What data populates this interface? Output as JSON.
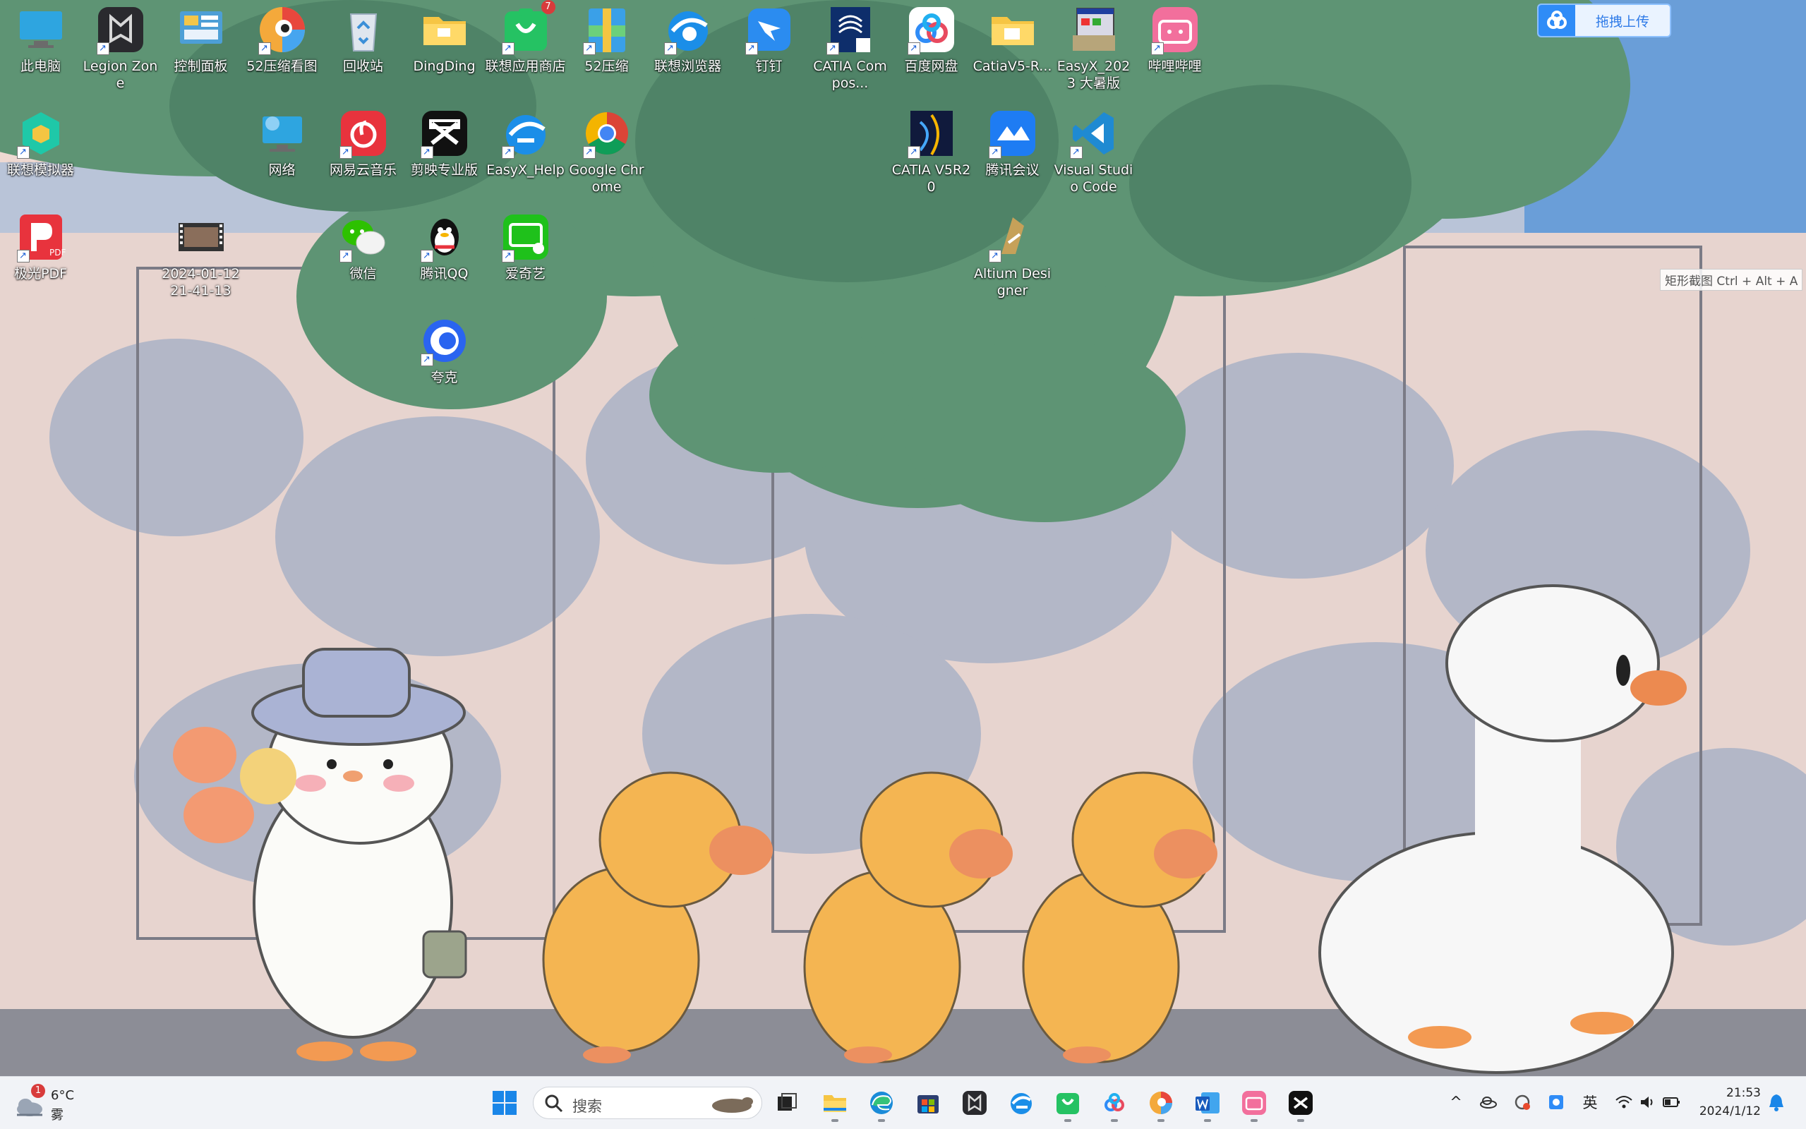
{
  "desktop": {
    "icons": [
      {
        "label": "此电脑",
        "icon": "computer-icon"
      },
      {
        "label": "Legion Zone",
        "icon": "legion-zone-icon"
      },
      {
        "label": "控制面板",
        "icon": "control-panel-icon"
      },
      {
        "label": "52压缩看图",
        "icon": "image-viewer-icon"
      },
      {
        "label": "回收站",
        "icon": "recycle-bin-icon"
      },
      {
        "label": "DingDing",
        "icon": "folder-icon"
      },
      {
        "label": "联想应用商店",
        "icon": "lenovo-app-store-icon",
        "badge": "7"
      },
      {
        "label": "52压缩",
        "icon": "zip-icon"
      },
      {
        "label": "联想浏览器",
        "icon": "lenovo-browser-icon"
      },
      {
        "label": "钉钉",
        "icon": "dingtalk-icon"
      },
      {
        "label": "CATIA Compos...",
        "icon": "catia-composer-icon"
      },
      {
        "label": "百度网盘",
        "icon": "baidu-netdisk-icon"
      },
      {
        "label": "CatiaV5-R...",
        "icon": "folder-icon"
      },
      {
        "label": "EasyX_2023 大暑版",
        "icon": "easyx-installer-icon"
      },
      {
        "label": "哔哩哔哩",
        "icon": "bilibili-icon"
      },
      {
        "label": "联想模拟器",
        "icon": "lenovo-emulator-icon"
      },
      {
        "label": "网络",
        "icon": "network-icon"
      },
      {
        "label": "网易云音乐",
        "icon": "netease-music-icon"
      },
      {
        "label": "剪映专业版",
        "icon": "capcut-icon"
      },
      {
        "label": "EasyX_Help",
        "icon": "easyx-help-icon"
      },
      {
        "label": "Google Chrome",
        "icon": "chrome-icon"
      },
      {
        "label": "CATIA V5R20",
        "icon": "catia-icon"
      },
      {
        "label": "腾讯会议",
        "icon": "tencent-meeting-icon"
      },
      {
        "label": "Visual Studio Code",
        "icon": "vscode-icon"
      },
      {
        "label": "极光PDF",
        "icon": "pdf-icon"
      },
      {
        "label": "2024-01-12 21-41-13",
        "icon": "video-file-icon"
      },
      {
        "label": "微信",
        "icon": "wechat-icon"
      },
      {
        "label": "腾讯QQ",
        "icon": "qq-icon"
      },
      {
        "label": "爱奇艺",
        "icon": "iqiyi-icon"
      },
      {
        "label": "Altium Designer",
        "icon": "altium-icon"
      },
      {
        "label": "夸克",
        "icon": "quark-icon"
      }
    ]
  },
  "upload_widget": {
    "label": "拖拽上传"
  },
  "screenshot_hint": "矩形截图 Ctrl + Alt + A",
  "taskbar": {
    "weather": {
      "temp": "6°C",
      "desc": "雾",
      "badge": "1"
    },
    "search_placeholder": "搜索",
    "pinned": [
      "start",
      "task-view",
      "file-explorer",
      "edge",
      "microsoft-store",
      "legion-zone",
      "lenovo-browser",
      "lenovo-app-store",
      "baidu-netdisk",
      "image-viewer",
      "word",
      "bilibili",
      "capcut"
    ],
    "tray": {
      "ime": "英"
    },
    "time": "21:53",
    "date": "2024/1/12"
  },
  "colors": {
    "taskbar_bg": "#f1f3f7",
    "accent": "#2f8cf7"
  }
}
